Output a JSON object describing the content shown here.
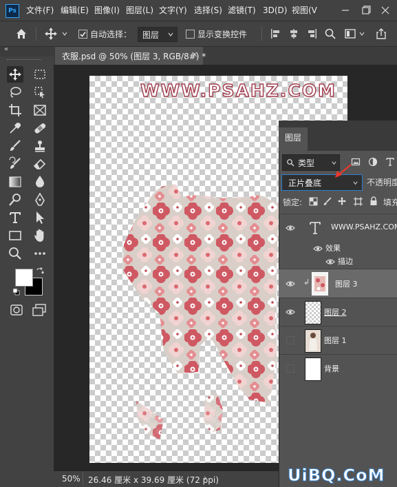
{
  "app": {
    "logo_text": "Ps"
  },
  "menu": [
    "文件(F)",
    "编辑(E)",
    "图像(I)",
    "图层(L)",
    "文字(Y)",
    "选择(S)",
    "滤镜(T)",
    "3D(D)",
    "视图(V"
  ],
  "options_bar": {
    "auto_select_label": "自动选择：",
    "auto_select_value": "图层",
    "show_transform_label": "显示变换控件"
  },
  "document_tab": {
    "title": "衣服.psd @ 50% (图层 3, RGB/8#) *"
  },
  "canvas": {
    "watermark": "WWW.PSAHZ.COM"
  },
  "status": {
    "zoom": "50%",
    "doc_size": "26.46 厘米 x 39.69 厘米 (72 ppi)"
  },
  "layers_panel": {
    "tab_label": "图层",
    "filter_value": "类型",
    "blend_mode": "正片叠底",
    "opacity_label": "不透明度",
    "lock_label": "锁定:",
    "fill_label": "填充",
    "layers": [
      {
        "name": "WWW.PSAHZ.COM",
        "type": "text",
        "visible": true,
        "effects_label": "效果",
        "effect_name": "描边"
      },
      {
        "name": "图层 3",
        "type": "pixel",
        "visible": true,
        "selected": true
      },
      {
        "name": "图层 2",
        "type": "pixel",
        "visible": true
      },
      {
        "name": "图层 1",
        "type": "pixel",
        "visible": false
      },
      {
        "name": "背景",
        "type": "pixel",
        "visible": false
      }
    ]
  },
  "watermark_bottom": "UiBQ.CoM",
  "colors": {
    "accent": "#31a8ff",
    "annotation_arrow": "#e8392c",
    "watermark_stroke": "#a03a4a"
  }
}
